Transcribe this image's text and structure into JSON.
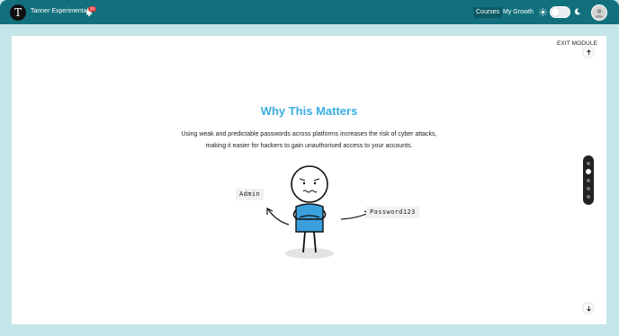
{
  "header": {
    "logo_letter": "T",
    "org_name": "Tanner Experimental",
    "notification_count": "20",
    "nav": {
      "courses": "Courses",
      "growth": "My Growth"
    },
    "theme_mode": "light"
  },
  "module": {
    "exit_label": "EXIT MODULE",
    "title": "Why This Matters",
    "description": "Using weak and predictable passwords across platforms increases the risk of cyber attacks, making it easier for hackers to gain unauthorised access to your accounts.",
    "illustration": {
      "left_label": "Admin",
      "right_label": "Password123"
    },
    "progress": {
      "total_steps": 5,
      "current_step": 2
    }
  },
  "colors": {
    "header_bg": "#12707d",
    "page_bg": "#c5e6e8",
    "title": "#3aaee0",
    "shirt": "#3aa0dc",
    "badge": "#e23b3b"
  }
}
